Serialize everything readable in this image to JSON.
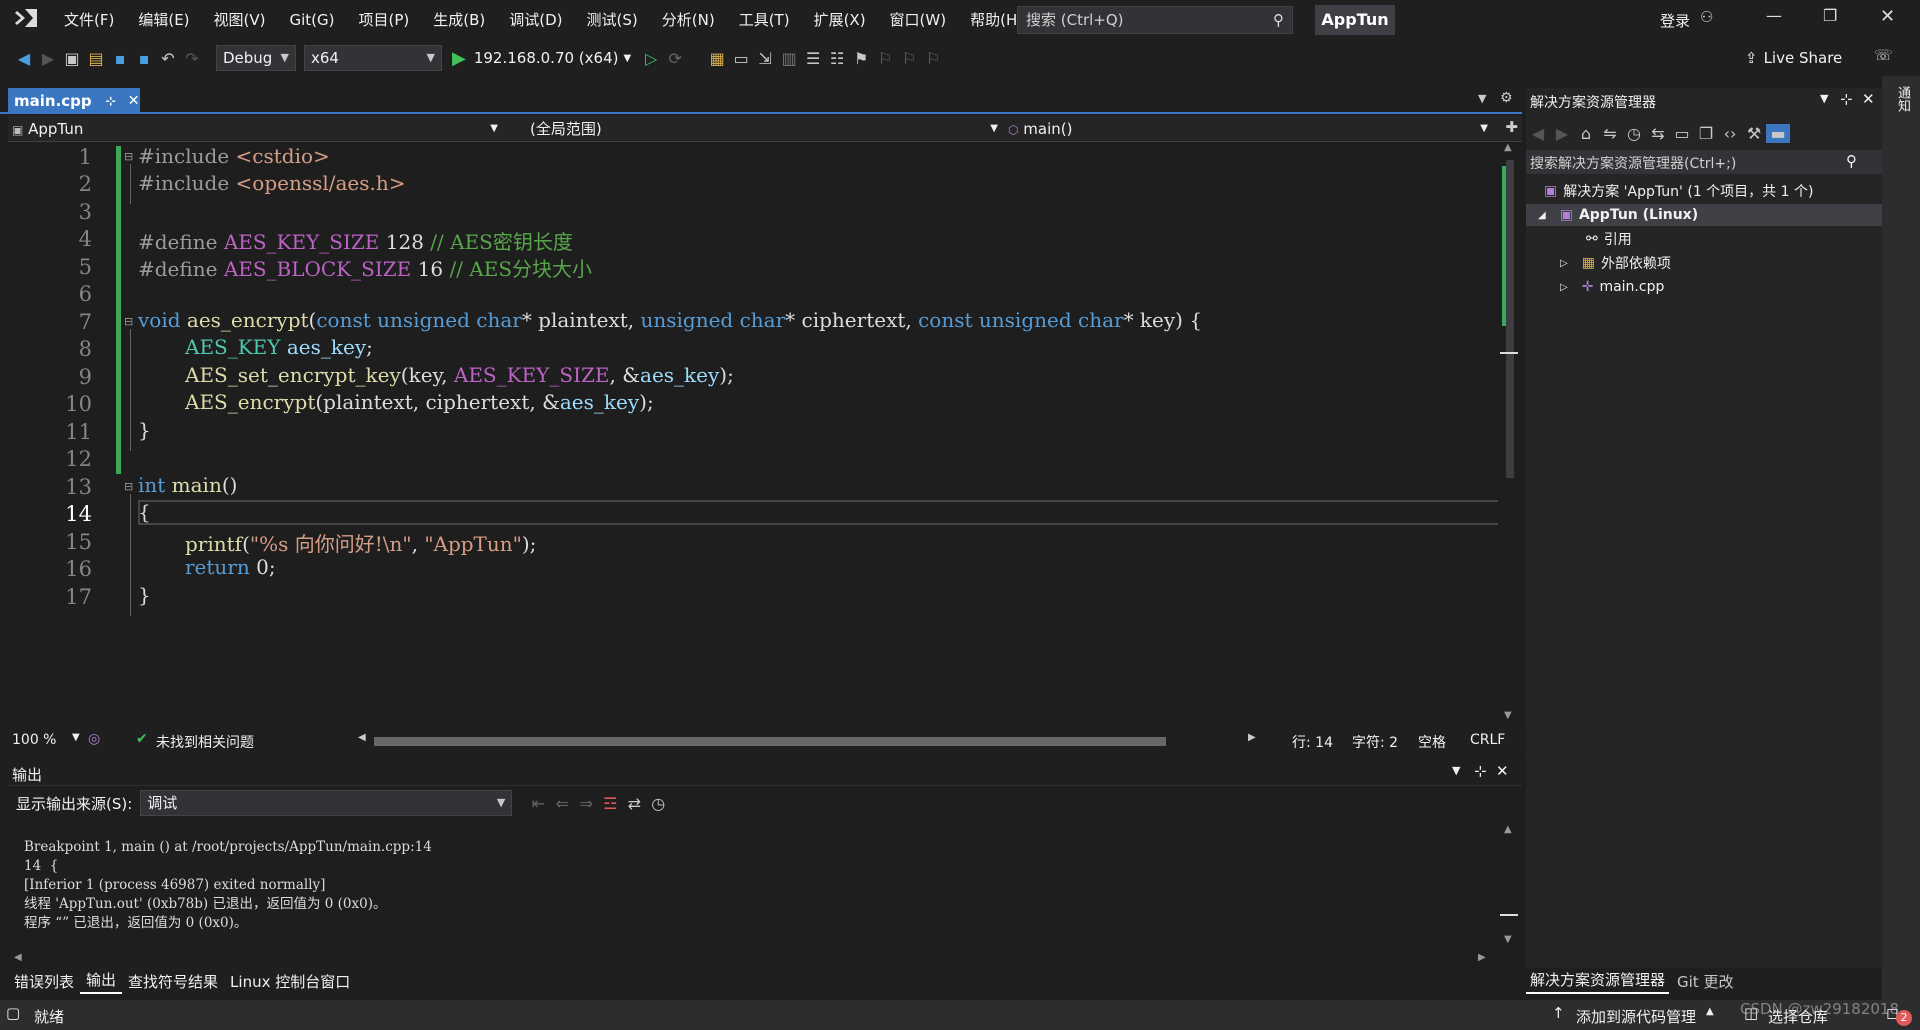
{
  "menu": [
    "文件(F)",
    "编辑(E)",
    "视图(V)",
    "Git(G)",
    "项目(P)",
    "生成(B)",
    "调试(D)",
    "测试(S)",
    "分析(N)",
    "工具(T)",
    "扩展(X)",
    "窗口(W)",
    "帮助(H)"
  ],
  "search": {
    "placeholder": "搜索 (Ctrl+Q)"
  },
  "app_name": "AppTun",
  "login": "登录",
  "toolbar": {
    "config": "Debug",
    "platform": "x64",
    "target": "192.168.0.70 (x64)",
    "live_share": "Live Share"
  },
  "doc_tab": {
    "name": "main.cpp"
  },
  "navbar": {
    "project": "AppTun",
    "scope": "(全局范围)",
    "member": "main()"
  },
  "line_numbers": [
    "1",
    "2",
    "3",
    "4",
    "5",
    "6",
    "7",
    "8",
    "9",
    "10",
    "11",
    "12",
    "13",
    "14",
    "15",
    "16",
    "17"
  ],
  "code": {
    "l1_a": "#include ",
    "l1_b": "<cstdio>",
    "l2_a": "#include ",
    "l2_b": "<openssl/aes.h>",
    "l4_a": "#define ",
    "l4_b": "AES_KEY_SIZE",
    "l4_c": " 128 ",
    "l4_d": "// AES密钥长度",
    "l5_a": "#define ",
    "l5_b": "AES_BLOCK_SIZE",
    "l5_c": " 16 ",
    "l5_d": "// AES分块大小",
    "l7_void": "void ",
    "l7_fn": "aes_encrypt",
    "l7_p1": "(",
    "l7_k1": "const unsigned char",
    "l7_v1": "* plaintext, ",
    "l7_k2": "unsigned char",
    "l7_v2": "* ciphertext, ",
    "l7_k3": "const unsigned char",
    "l7_v3": "* key) {",
    "l8_ty": "AES_KEY ",
    "l8_var": "aes_key",
    ";": ";",
    "l9_fn": "AES_set_encrypt_key",
    "l9_a": "(key, ",
    "l9_mac": "AES_KEY_SIZE",
    "l9_b": ", &",
    "l9_var": "aes_key",
    "l9_c": ");",
    "l10_fn": "AES_encrypt",
    "l10_a": "(plaintext, ciphertext, &",
    "l10_var": "aes_key",
    "l10_b": ");",
    "l11": "}",
    "l13_kw": "int ",
    "l13_fn": "main",
    "l13_b": "()",
    "l14": "{",
    "l15_fn": "printf",
    "l15_a": "(",
    "l15_s1": "\"%s 向你问好!\\n\"",
    "l15_b": ", ",
    "l15_s2": "\"AppTun\"",
    "l15_c": ");",
    "l16_kw": "return ",
    "l16_b": "0;",
    "l17": "}"
  },
  "editor_status": {
    "zoom": "100 %",
    "issues": "未找到相关问题",
    "line": "行: 14",
    "col": "字符: 2",
    "spaces": "空格",
    "eol": "CRLF"
  },
  "output": {
    "title": "输出",
    "source_label": "显示输出来源(S):",
    "source_value": "调试",
    "lines": [
      "Breakpoint 1, main () at /root/projects/AppTun/main.cpp:14",
      "14  {",
      "[Inferior 1 (process 46987) exited normally]",
      "线程 'AppTun.out' (0xb78b) 已退出，返回值为 0 (0x0)。",
      "程序 “” 已退出，返回值为 0 (0x0)。"
    ]
  },
  "bottom_tabs": [
    "错误列表",
    "输出",
    "查找符号结果",
    "Linux 控制台窗口"
  ],
  "solution": {
    "title": "解决方案资源管理器",
    "search": "搜索解决方案资源管理器(Ctrl+;)",
    "root": "解决方案 'AppTun' (1 个项目，共 1 个)",
    "project": "AppTun (Linux)",
    "items": [
      "引用",
      "外部依赖项",
      "main.cpp"
    ]
  },
  "sol_tabs": [
    "解决方案资源管理器",
    "Git 更改"
  ],
  "vert_label": "通知",
  "status": {
    "ready": "就绪",
    "add_source": "添加到源代码管理",
    "select_repo": "选择仓库",
    "watermark": "CSDN @zw29182018",
    "badge": "2"
  }
}
